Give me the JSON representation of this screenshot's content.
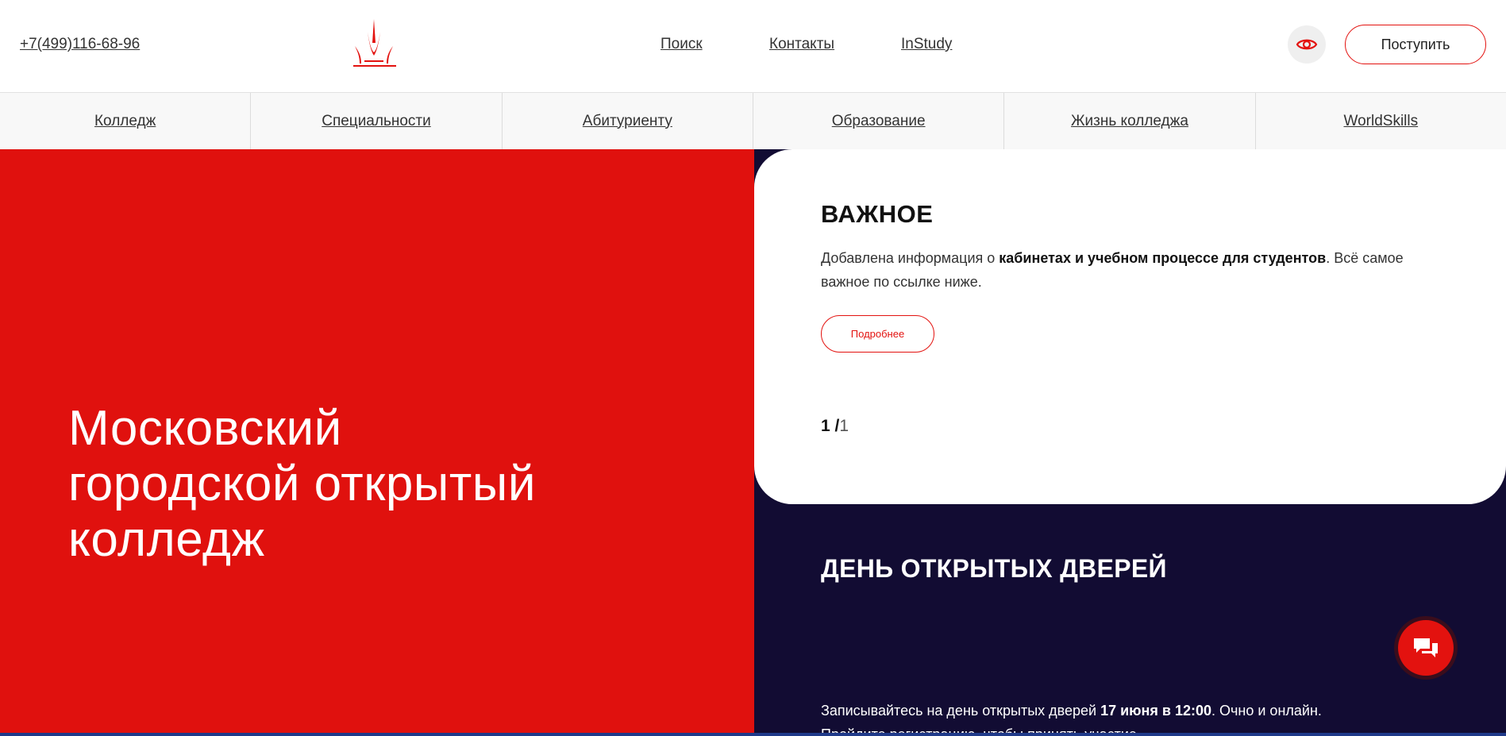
{
  "header": {
    "phone": "+7(499)116-68-96",
    "nav": [
      {
        "label": "Поиск"
      },
      {
        "label": "Контакты"
      },
      {
        "label": "InStudy"
      }
    ],
    "apply_label": "Поступить",
    "accent_color": "#e3120f"
  },
  "main_nav": [
    {
      "label": "Колледж"
    },
    {
      "label": "Специальности"
    },
    {
      "label": "Абитуриенту"
    },
    {
      "label": "Образование"
    },
    {
      "label": "Жизнь колледжа"
    },
    {
      "label": "WorldSkills"
    }
  ],
  "hero": {
    "title_lines": [
      "Московский",
      "городской открытый",
      "колледж"
    ],
    "background_color": "#e0110e"
  },
  "important": {
    "title": "ВАЖНОЕ",
    "text_before": "Добавлена информация о ",
    "text_bold": "кабинетах и учебном процессе для студентов",
    "text_after": ". Всё самое важное по ссылке ниже.",
    "button_label": "Подробнее",
    "pager_current": "1 /",
    "pager_total": "1"
  },
  "open_day": {
    "title": "ДЕНЬ ОТКРЫТЫХ ДВЕРЕЙ",
    "text_before": "Записывайтесь на день открытых дверей ",
    "text_bold": "17 июня в 12:00",
    "text_after": ". Очно и онлайн.",
    "text_line2": "Пройдите регистрацию, чтобы принять участие",
    "background_color": "#120c33"
  },
  "icons": {
    "logo": "college-logo-icon",
    "eye": "eye-icon",
    "chat": "chat-icon"
  }
}
